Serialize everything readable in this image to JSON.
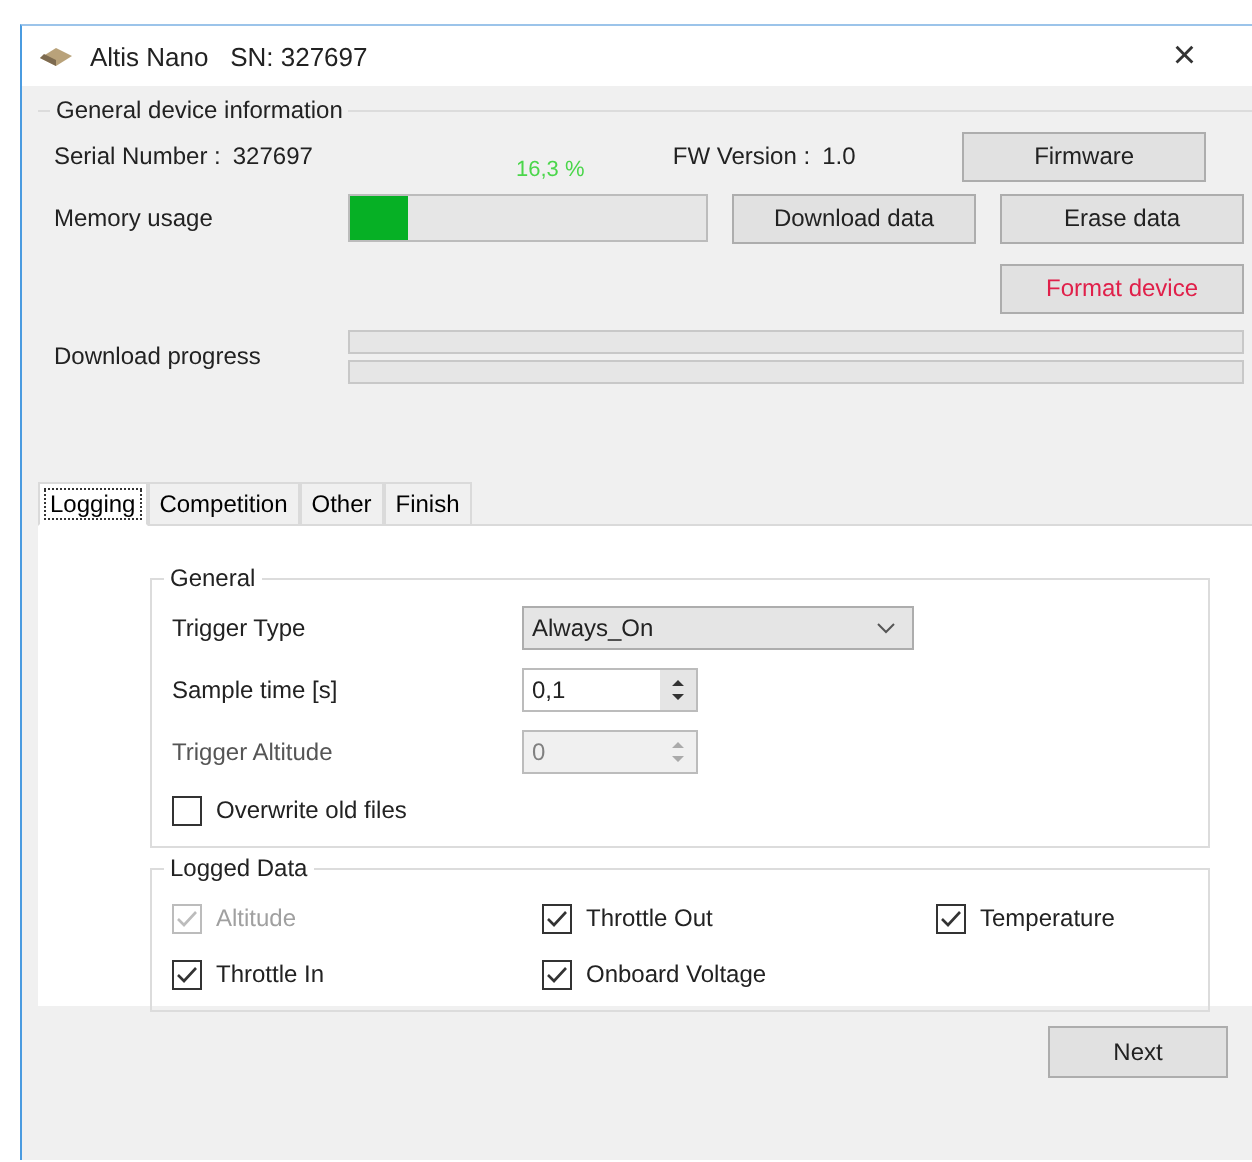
{
  "window": {
    "title": "Altis Nano   SN: 327697",
    "close": "×"
  },
  "device_info": {
    "title": "General device information",
    "serial_label": "Serial Number :",
    "serial_value": "327697",
    "fw_label": "FW Version :",
    "fw_value": "1.0",
    "memory_label": "Memory usage",
    "memory_percent": "16,3 %",
    "memory_bar": {
      "level": 0.163
    },
    "download_label": "Download progress",
    "download_bars": [
      {
        "level": 0
      },
      {
        "level": 0
      }
    ],
    "buttons": [
      {
        "label": "Firmware",
        "kind": "normal"
      },
      {
        "label": "Download data",
        "kind": "normal"
      },
      {
        "label": "Erase data",
        "kind": "normal"
      },
      {
        "label": "Format device",
        "kind": "danger"
      }
    ]
  },
  "tabs": [
    {
      "label": "Logging",
      "selected": true
    },
    {
      "label": "Competition",
      "selected": false
    },
    {
      "label": "Other",
      "selected": false
    },
    {
      "label": "Finish",
      "selected": false
    }
  ],
  "general": {
    "title": "General",
    "trigger_type": {
      "label": "Trigger Type",
      "value": "Always_On"
    },
    "sample_time": {
      "label": "Sample time [s]",
      "value": "0,1",
      "disabled": false
    },
    "trigger_altitude": {
      "label": "Trigger Altitude",
      "value": "0",
      "disabled": true
    },
    "overwrite": {
      "label": "Overwrite old files",
      "checked": false,
      "disabled": false
    }
  },
  "logged_data": {
    "title": "Logged Data",
    "items": [
      {
        "label": "Altitude",
        "checked": true,
        "disabled": true
      },
      {
        "label": "Throttle Out",
        "checked": true,
        "disabled": false
      },
      {
        "label": "Temperature",
        "checked": true,
        "disabled": false
      },
      {
        "label": "Throttle In",
        "checked": true,
        "disabled": false
      },
      {
        "label": "Onboard Voltage",
        "checked": true,
        "disabled": false
      }
    ]
  },
  "next_button": "Next"
}
